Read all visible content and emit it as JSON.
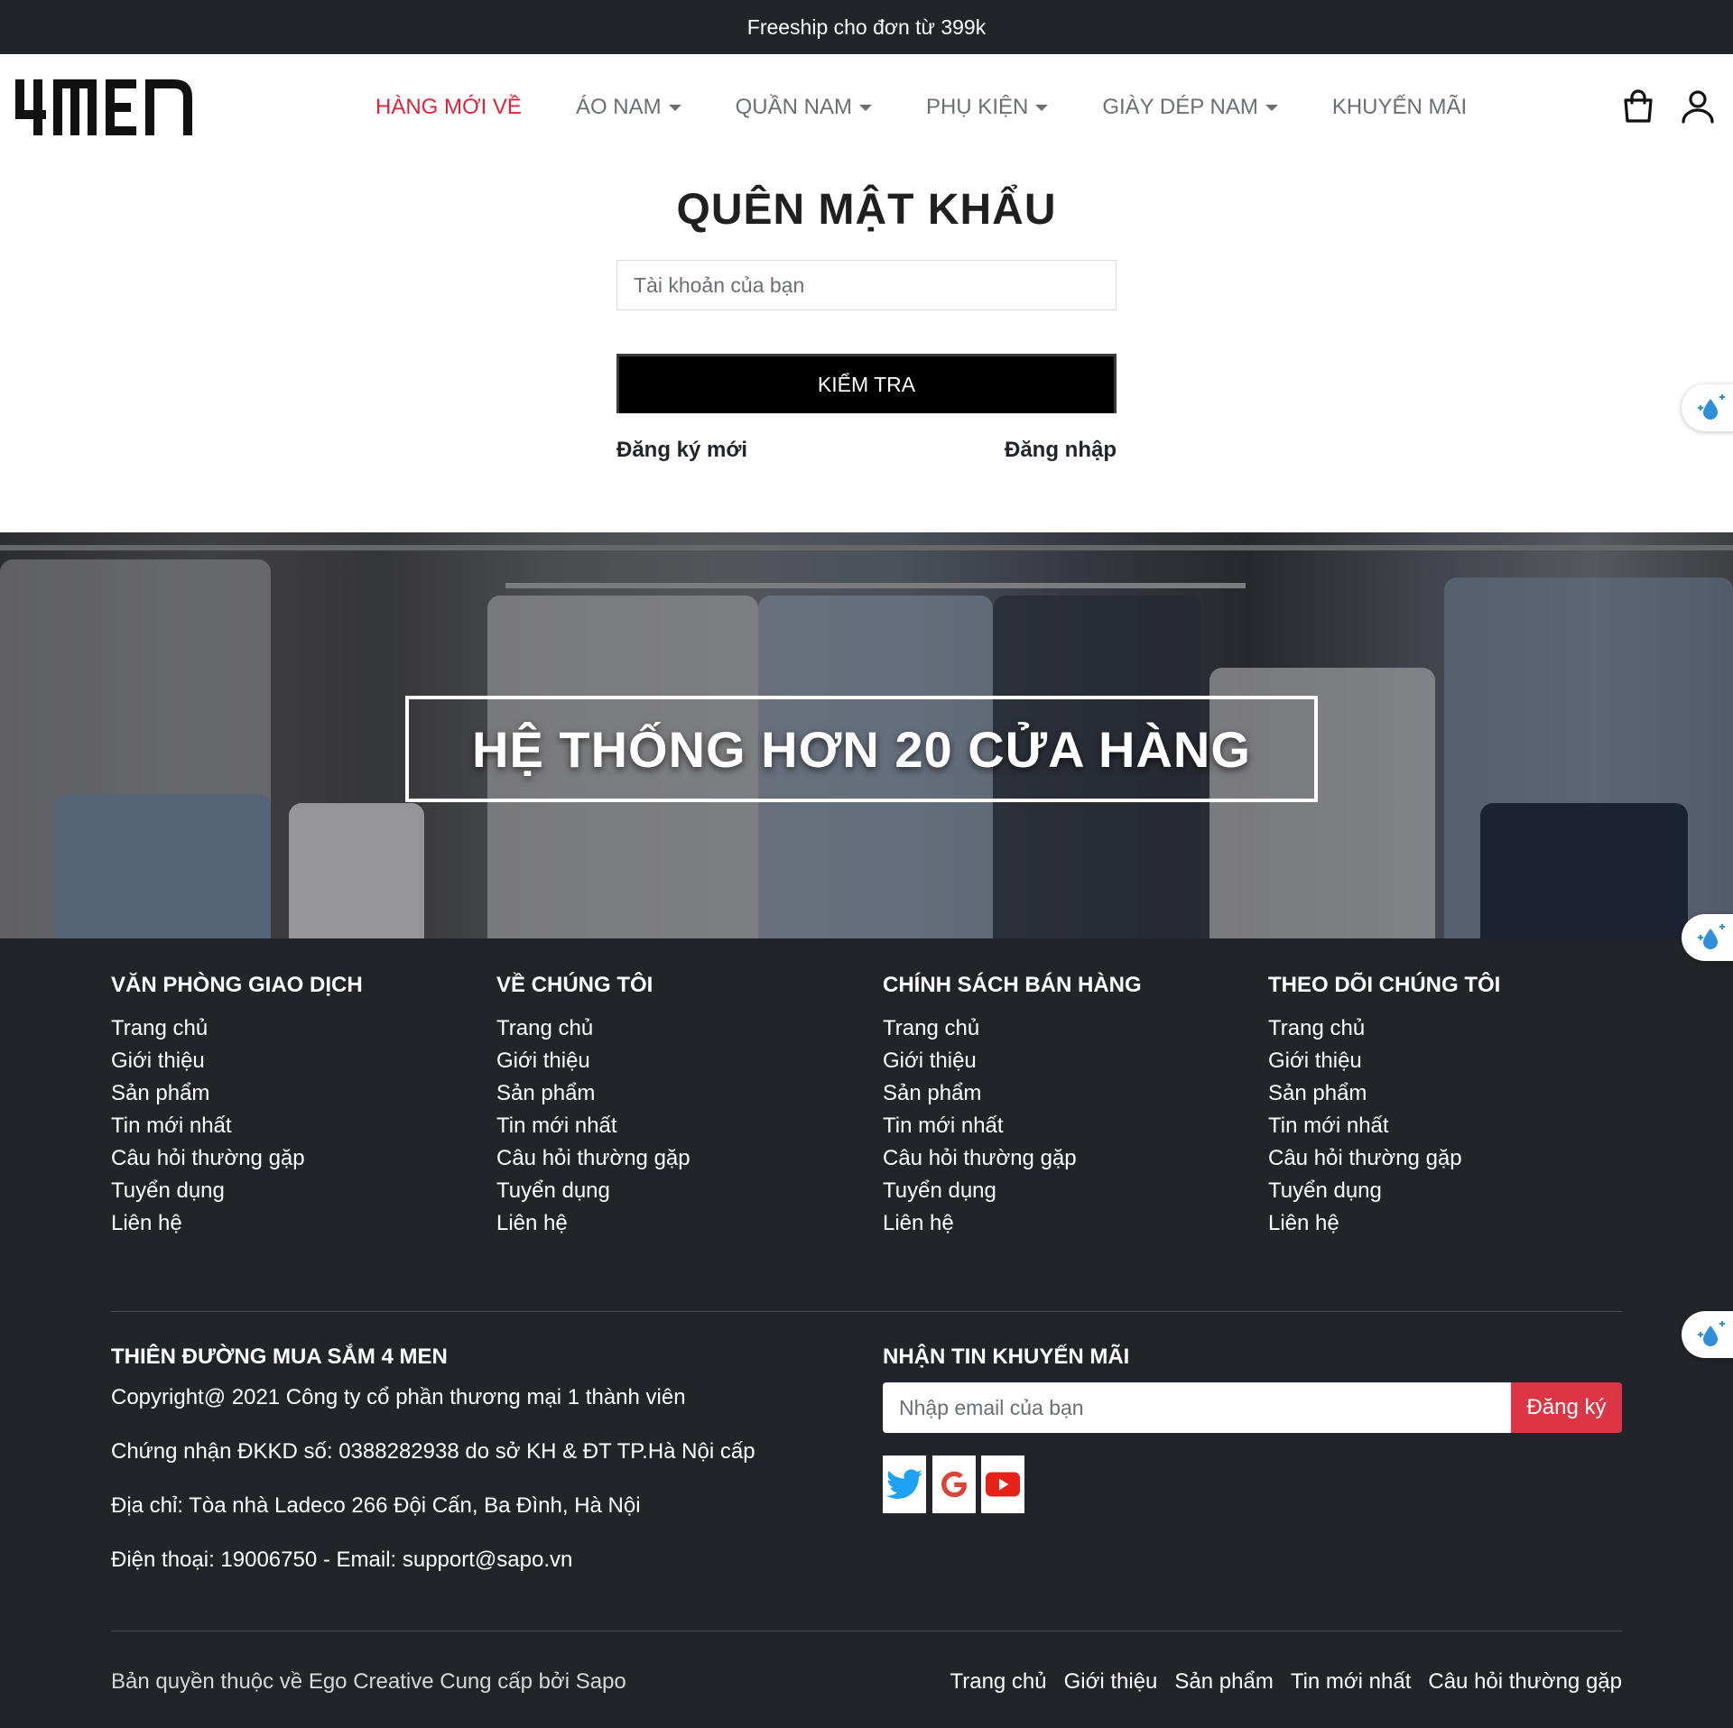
{
  "topbar": {
    "text": "Freeship cho đơn từ 399k"
  },
  "header": {
    "logo_text": "4MEN",
    "nav": [
      {
        "label": "HÀNG MỚI VỀ",
        "active": true,
        "dropdown": false
      },
      {
        "label": "ÁO NAM",
        "active": false,
        "dropdown": true
      },
      {
        "label": "QUẦN NAM",
        "active": false,
        "dropdown": true
      },
      {
        "label": "PHỤ KIỆN",
        "active": false,
        "dropdown": true
      },
      {
        "label": "GIÀY DÉP NAM",
        "active": false,
        "dropdown": true
      },
      {
        "label": "KHUYẾN MÃI",
        "active": false,
        "dropdown": false
      }
    ],
    "icons": [
      "shopping-bag-icon",
      "user-icon"
    ]
  },
  "form": {
    "title": "QUÊN MẬT KHẨU",
    "account_placeholder": "Tài khoản của bạn",
    "account_value": "",
    "submit_label": "KIỂM TRA",
    "register_link": "Đăng ký mới",
    "login_link": "Đăng nhập"
  },
  "banner": {
    "text": "HỆ THỐNG HƠN 20 CỬA HÀNG"
  },
  "footer": {
    "columns": [
      {
        "title": "VĂN PHÒNG GIAO DỊCH",
        "links": [
          "Trang chủ",
          "Giới thiệu",
          "Sản phẩm",
          "Tin mới nhất",
          "Câu hỏi thường gặp",
          "Tuyển dụng",
          "Liên hệ"
        ]
      },
      {
        "title": "VỀ CHÚNG TÔI",
        "links": [
          "Trang chủ",
          "Giới thiệu",
          "Sản phẩm",
          "Tin mới nhất",
          "Câu hỏi thường gặp",
          "Tuyển dụng",
          "Liên hệ"
        ]
      },
      {
        "title": "CHÍNH SÁCH BÁN HÀNG",
        "links": [
          "Trang chủ",
          "Giới thiệu",
          "Sản phẩm",
          "Tin mới nhất",
          "Câu hỏi thường gặp",
          "Tuyển dụng",
          "Liên hệ"
        ]
      },
      {
        "title": "THEO DÕI CHÚNG TÔI",
        "links": [
          "Trang chủ",
          "Giới thiệu",
          "Sản phẩm",
          "Tin mới nhất",
          "Câu hỏi thường gặp",
          "Tuyển dụng",
          "Liên hệ"
        ]
      }
    ],
    "info": {
      "title": "THIÊN ĐƯỜNG MUA SẮM 4 MEN",
      "lines": [
        "Copyright@ 2021 Công ty cổ phần thương mại 1 thành viên",
        "Chứng nhận ĐKKD số: 0388282938 do sở KH & ĐT TP.Hà Nội cấp",
        "Địa chỉ: Tòa nhà Ladeco 266 Đội Cấn, Ba Đình, Hà Nội",
        "Điện thoại: 19006750 - Email: support@sapo.vn"
      ]
    },
    "newsletter": {
      "title": "NHẬN TIN KHUYẾN MÃI",
      "placeholder": "Nhập email của bạn",
      "button_label": "Đăng ký"
    },
    "social_icons": [
      "twitter-icon",
      "google-icon",
      "youtube-icon"
    ],
    "copyright": "Bản quyền thuộc về Ego Creative Cung cấp bởi Sapo",
    "bottom_links": [
      "Trang chủ",
      "Giới thiệu",
      "Sản phẩm",
      "Tin mới nhất",
      "Câu hỏi thường gặp"
    ]
  },
  "colors": {
    "dark": "#212529",
    "accent_red": "#dc3545",
    "nav_active": "#d7263d",
    "nav_text": "#6b6f73"
  }
}
